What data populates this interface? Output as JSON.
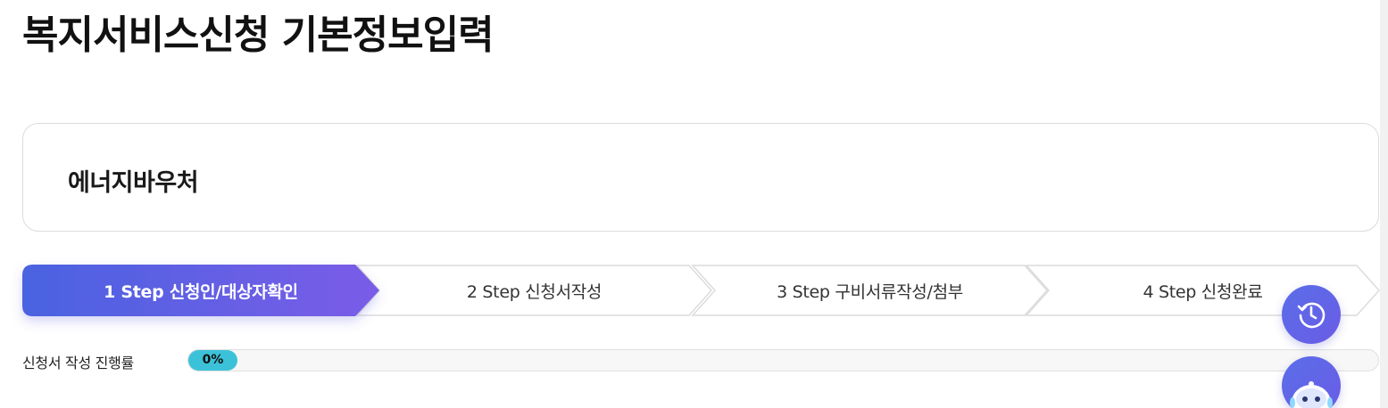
{
  "page": {
    "title": "복지서비스신청 기본정보입력"
  },
  "service": {
    "name": "에너지바우처"
  },
  "steps": [
    {
      "label": "1 Step 신청인/대상자확인",
      "active": true
    },
    {
      "label": "2 Step 신청서작성",
      "active": false
    },
    {
      "label": "3 Step 구비서류작성/첨부",
      "active": false
    },
    {
      "label": "4 Step 신청완료",
      "active": false
    }
  ],
  "progress": {
    "label": "신청서 작성 진행률",
    "percent": 0,
    "display": "0%"
  },
  "floating": {
    "history_icon": "history-icon",
    "chatbot_icon": "chatbot-icon"
  },
  "colors": {
    "active_step_start": "#4a63e0",
    "active_step_end": "#7a5ce8",
    "progress_fill": "#3cc2d8"
  }
}
